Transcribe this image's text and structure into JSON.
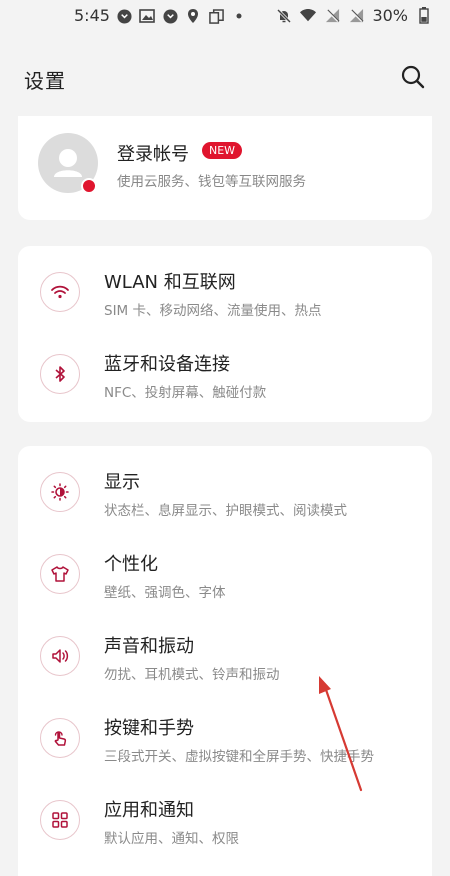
{
  "status_bar": {
    "time": "5:45",
    "battery_percent": "30%",
    "icons_left": [
      "notification-icon",
      "gallery-icon",
      "notification-icon",
      "location-icon",
      "copy-icon",
      "dot-icon"
    ],
    "icons_right": [
      "mute-icon",
      "wifi-icon",
      "no-signal-icon",
      "no-signal-icon",
      "battery-icon"
    ]
  },
  "header": {
    "title": "设置"
  },
  "account": {
    "title": "登录帐号",
    "badge": "NEW",
    "subtitle": "使用云服务、钱包等互联网服务"
  },
  "network_group": [
    {
      "icon": "wifi-icon",
      "title": "WLAN 和互联网",
      "subtitle": "SIM 卡、移动网络、流量使用、热点"
    },
    {
      "icon": "bluetooth-icon",
      "title": "蓝牙和设备连接",
      "subtitle": "NFC、投射屏幕、触碰付款"
    }
  ],
  "main_group": [
    {
      "icon": "brightness-icon",
      "title": "显示",
      "subtitle": "状态栏、息屏显示、护眼模式、阅读模式"
    },
    {
      "icon": "tshirt-icon",
      "title": "个性化",
      "subtitle": "壁纸、强调色、字体"
    },
    {
      "icon": "speaker-icon",
      "title": "声音和振动",
      "subtitle": "勿扰、耳机模式、铃声和振动"
    },
    {
      "icon": "gesture-icon",
      "title": "按键和手势",
      "subtitle": "三段式开关、虚拟按键和全屏手势、快捷手势"
    },
    {
      "icon": "apps-icon",
      "title": "应用和通知",
      "subtitle": "默认应用、通知、权限"
    }
  ],
  "colors": {
    "accent": "#e0152e",
    "icon_stroke": "#b0123a",
    "background": "#f3f3f3"
  }
}
